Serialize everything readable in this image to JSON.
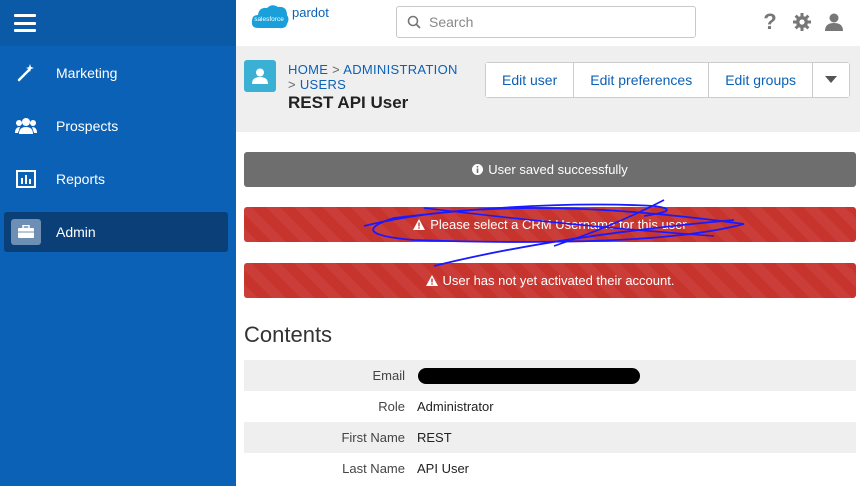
{
  "sidebar": {
    "items": [
      {
        "label": "Marketing",
        "icon": "wand-icon"
      },
      {
        "label": "Prospects",
        "icon": "users-icon"
      },
      {
        "label": "Reports",
        "icon": "chart-icon"
      },
      {
        "label": "Admin",
        "icon": "briefcase-icon",
        "active": true
      }
    ]
  },
  "topbar": {
    "brand_cloud": "salesforce",
    "brand_product": "pardot",
    "search_placeholder": "Search"
  },
  "header": {
    "breadcrumb": [
      "HOME",
      "ADMINISTRATION",
      "USERS"
    ],
    "title": "REST API User",
    "actions": [
      "Edit user",
      "Edit preferences",
      "Edit groups"
    ]
  },
  "alerts": [
    {
      "type": "info",
      "text": "User saved successfully"
    },
    {
      "type": "warning",
      "text": "Please select a CRM Username for this user"
    },
    {
      "type": "warning",
      "text": "User has not yet activated their account."
    }
  ],
  "contents": {
    "title": "Contents",
    "fields": [
      {
        "label": "Email",
        "value": ""
      },
      {
        "label": "Role",
        "value": "Administrator"
      },
      {
        "label": "First Name",
        "value": "REST"
      },
      {
        "label": "Last Name",
        "value": "API User"
      }
    ]
  },
  "colors": {
    "sidebar": "#0b61b5",
    "alert_red": "#c7332d",
    "alert_gray": "#6e6e6e",
    "link": "#0b61b5"
  }
}
